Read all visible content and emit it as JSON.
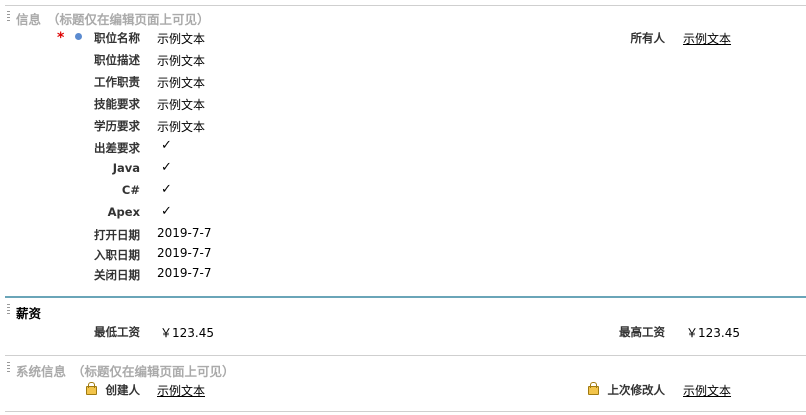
{
  "info": {
    "title": "信息",
    "note": "（标题仅在编辑页面上可见）",
    "fields": {
      "job_name": {
        "label": "职位名称",
        "value": "示例文本"
      },
      "job_desc": {
        "label": "职位描述",
        "value": "示例文本"
      },
      "duties": {
        "label": "工作职责",
        "value": "示例文本"
      },
      "skills": {
        "label": "技能要求",
        "value": "示例文本"
      },
      "education": {
        "label": "学历要求",
        "value": "示例文本"
      },
      "travel": {
        "label": "出差要求",
        "value": "✓"
      },
      "java": {
        "label": "Java",
        "value": "✓"
      },
      "csharp": {
        "label": "C#",
        "value": "✓"
      },
      "apex": {
        "label": "Apex",
        "value": "✓"
      },
      "open_date": {
        "label": "打开日期",
        "value": "2019-7-7"
      },
      "hire_date": {
        "label": "入职日期",
        "value": "2019-7-7"
      },
      "close_date": {
        "label": "关闭日期",
        "value": "2019-7-7"
      }
    },
    "owner": {
      "label": "所有人",
      "value": "示例文本"
    },
    "required_mark": "*"
  },
  "salary": {
    "title": "薪资",
    "min": {
      "label": "最低工资",
      "value": "￥123.45"
    },
    "max": {
      "label": "最高工资",
      "value": "￥123.45"
    }
  },
  "system": {
    "title": "系统信息",
    "note": "（标题仅在编辑页面上可见）",
    "created_by": {
      "label": "创建人",
      "value": "示例文本"
    },
    "modified_by": {
      "label": "上次修改人",
      "value": "示例文本"
    }
  },
  "colors": {
    "salary_rule": "#6aa5b8",
    "rule": "#c8c8c8",
    "required": "#dd0000",
    "dot": "#5b8bd0"
  }
}
